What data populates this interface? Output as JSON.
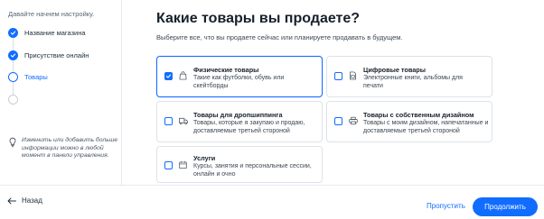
{
  "sidebar": {
    "intro": "Давайте начнем настройку.",
    "steps": [
      {
        "label": "Название магазина",
        "state": "done"
      },
      {
        "label": "Присутствие онлайн",
        "state": "done"
      },
      {
        "label": "Товары",
        "state": "current"
      },
      {
        "label": "",
        "state": "pending"
      }
    ],
    "tip": "Изменить или добавить больше информации можно в любой момент в панели управления."
  },
  "main": {
    "title": "Какие товары вы продаете?",
    "subtitle": "Выберите все, что вы продаете сейчас или планируете продавать в будущем.",
    "cards": [
      {
        "title": "Физические товары",
        "desc": "Такие как футболки, обувь или скейтборды",
        "checked": true,
        "icon": "bag-icon"
      },
      {
        "title": "Цифровые товары",
        "desc": "Электронные книги, альбомы для печати",
        "checked": false,
        "icon": "digital-file-icon"
      },
      {
        "title": "Товары для дропшиппинга",
        "desc": "Товары, которые я закупаю и продаю, доставляемые третьей стороной",
        "checked": false,
        "icon": "truck-icon"
      },
      {
        "title": "Товары с собственным дизайном",
        "desc": "Товары с моим дизайном, напечатанные и доставляемые третьей стороной",
        "checked": false,
        "icon": "printer-icon"
      },
      {
        "title": "Услуги",
        "desc": "Курсы, занятия и персональные сессии, онлайн и очно",
        "checked": false,
        "icon": "calendar-icon"
      }
    ]
  },
  "footer": {
    "back_label": "Назад",
    "skip_label": "Пропустить",
    "next_label": "Продолжить"
  },
  "colors": {
    "accent": "#116dff",
    "text": "#20303c",
    "border": "#dde3ea"
  }
}
